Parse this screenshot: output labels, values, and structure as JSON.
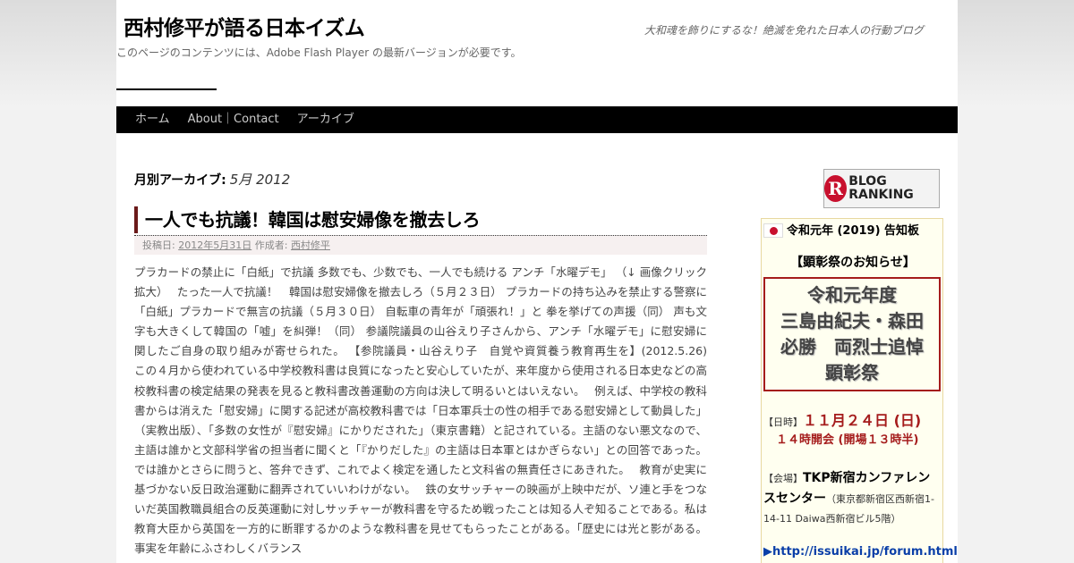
{
  "site": {
    "title": "西村修平が語る日本イズム",
    "description": "大和魂を飾りにするな！絶滅を免れた日本人の行動ブログ",
    "flash_note": "このページのコンテンツには、Adobe Flash Player の最新バージョンが必要です。"
  },
  "nav": {
    "items": [
      {
        "label": "ホーム"
      },
      {
        "label": "About｜Contact"
      },
      {
        "label": "アーカイブ"
      }
    ]
  },
  "archive": {
    "label": "月別アーカイブ:",
    "month": "5月 2012"
  },
  "post": {
    "title": "一人でも抗議！韓国は慰安婦像を撤去しろ",
    "meta_posted_label": "投稿日:",
    "meta_date": "2012年5月31日",
    "meta_author_label": "作成者:",
    "meta_author": "西村修平",
    "body": "プラカードの禁止に「白紙」で抗議 多数でも、少数でも、一人でも続ける アンチ「水曜デモ」 （↓ 画像クリック拡大）　 たった一人で抗議！　韓国は慰安婦像を撤去しろ（５月２３日） プラカードの持ち込みを禁止する警察に「白紙」プラカードで無言の抗議（５月３０日） 自転車の青年が「頑張れ！」と 拳を挙げての声援（同） 声も文字も大きくして韓国の「嘘」を糾弾！（同） 参議院議員の山谷えり子さんから、アンチ「水曜デモ」に慰安婦に関したご自身の取り組みが寄せられた。 【参院議員・山谷えり子　自覚や資質養う教育再生を】(2012.5.26)　 この４月から使われている中学校教科書は良質になったと安心していたが、来年度から使用される日本史などの高校教科書の検定結果の発表を見ると教科書改善運動の方向は決して明るいとはいえない。　 例えば、中学校の教科書からは消えた「慰安婦」に関する記述が高校教科書では「日本軍兵士の性の相手である慰安婦として動員した」（実教出版）、「多数の女性が『慰安婦』にかりだされた」（東京書籍）と記されている。主語のない悪文なので、主語は誰かと文部科学省の担当者に聞くと「『かりだした』の主語は日本軍とはかぎらない」との回答であった。では誰かとさらに問うと、答弁できず、これでよく検定を通したと文科省の無責任さにあきれた。　 教育が史実に基づかない反日政治運動に翻弄されていいわけがない。　 鉄の女サッチャーの映画が上映中だが、ソ連と手をつないだ英国教職員組合の反英運動に対しサッチャーが教科書を守るため戦ったことは知る人ぞ知ることである。私は教育大臣から英国を一方的に断罪するかのような教科書を見せてもらったことがある。「歴史には光と影がある。事実を年齢にふさわしくバランス"
  },
  "sidebar": {
    "ranking_logo_text": "BLOG RANKING",
    "ranking_logo_letter": "R",
    "notice": {
      "heading": "令和元年 (2019) 告知板",
      "subheading": "【顕彰祭のお知らせ】",
      "box_lines": [
        "令和元年度",
        "三島由紀夫・森田",
        "必勝　両烈士追悼",
        "顕彰祭"
      ],
      "date_label": "【日時】",
      "date_value": "１１月２４日 (日)",
      "time_value": "１４時開会 (開場１３時半)",
      "venue_label": "【会場】",
      "venue_name": "TKP新宿カンファレンスセンター",
      "venue_address": "（東京都新宿区西新宿1-14-11 Daiwa西新宿ビル5階）",
      "link_text": "http://issuikai.jp/forum.html"
    }
  }
}
